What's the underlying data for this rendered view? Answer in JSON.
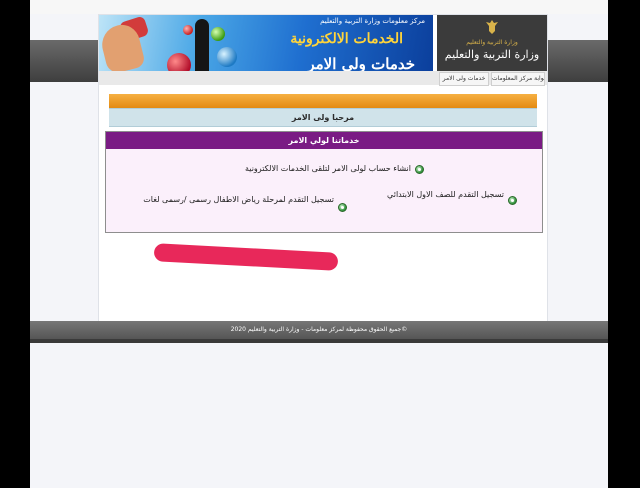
{
  "banner": {
    "subtitle": "مركز معلومات وزارة التربية والتعليم",
    "title": "الخدمات الالكترونية",
    "subtitle2": "خدمات ولي الامر"
  },
  "logo": {
    "tagline": "وزارة التربية والتعليم",
    "name": "وزارة التربية والتعليم"
  },
  "nav": {
    "items": [
      {
        "label": "بوابة مركز المعلومات"
      },
      {
        "label": "خدمات ولى الامر"
      }
    ]
  },
  "welcome": "مرحبا ولى الامر",
  "services": {
    "header": "خدماتنا لولي الامر",
    "items": [
      {
        "label": "انشاء حساب لولى الامر لتلقى الخدمات الالكترونية"
      },
      {
        "label": "تسجيل التقدم للصف الاول الابتدائي"
      },
      {
        "label": "تسجيل التقدم لمرحلة رياض الاطفال رسمى /رسمى لغات"
      }
    ]
  },
  "footer": {
    "text": "جميع الحقوق محفوظة لمركز معلومات - وزارة التربية والتعليم 2020©"
  },
  "colors": {
    "accent_orange": "#e48a12",
    "header_purple": "#7a1b84",
    "scribble_red": "#e8285a"
  }
}
